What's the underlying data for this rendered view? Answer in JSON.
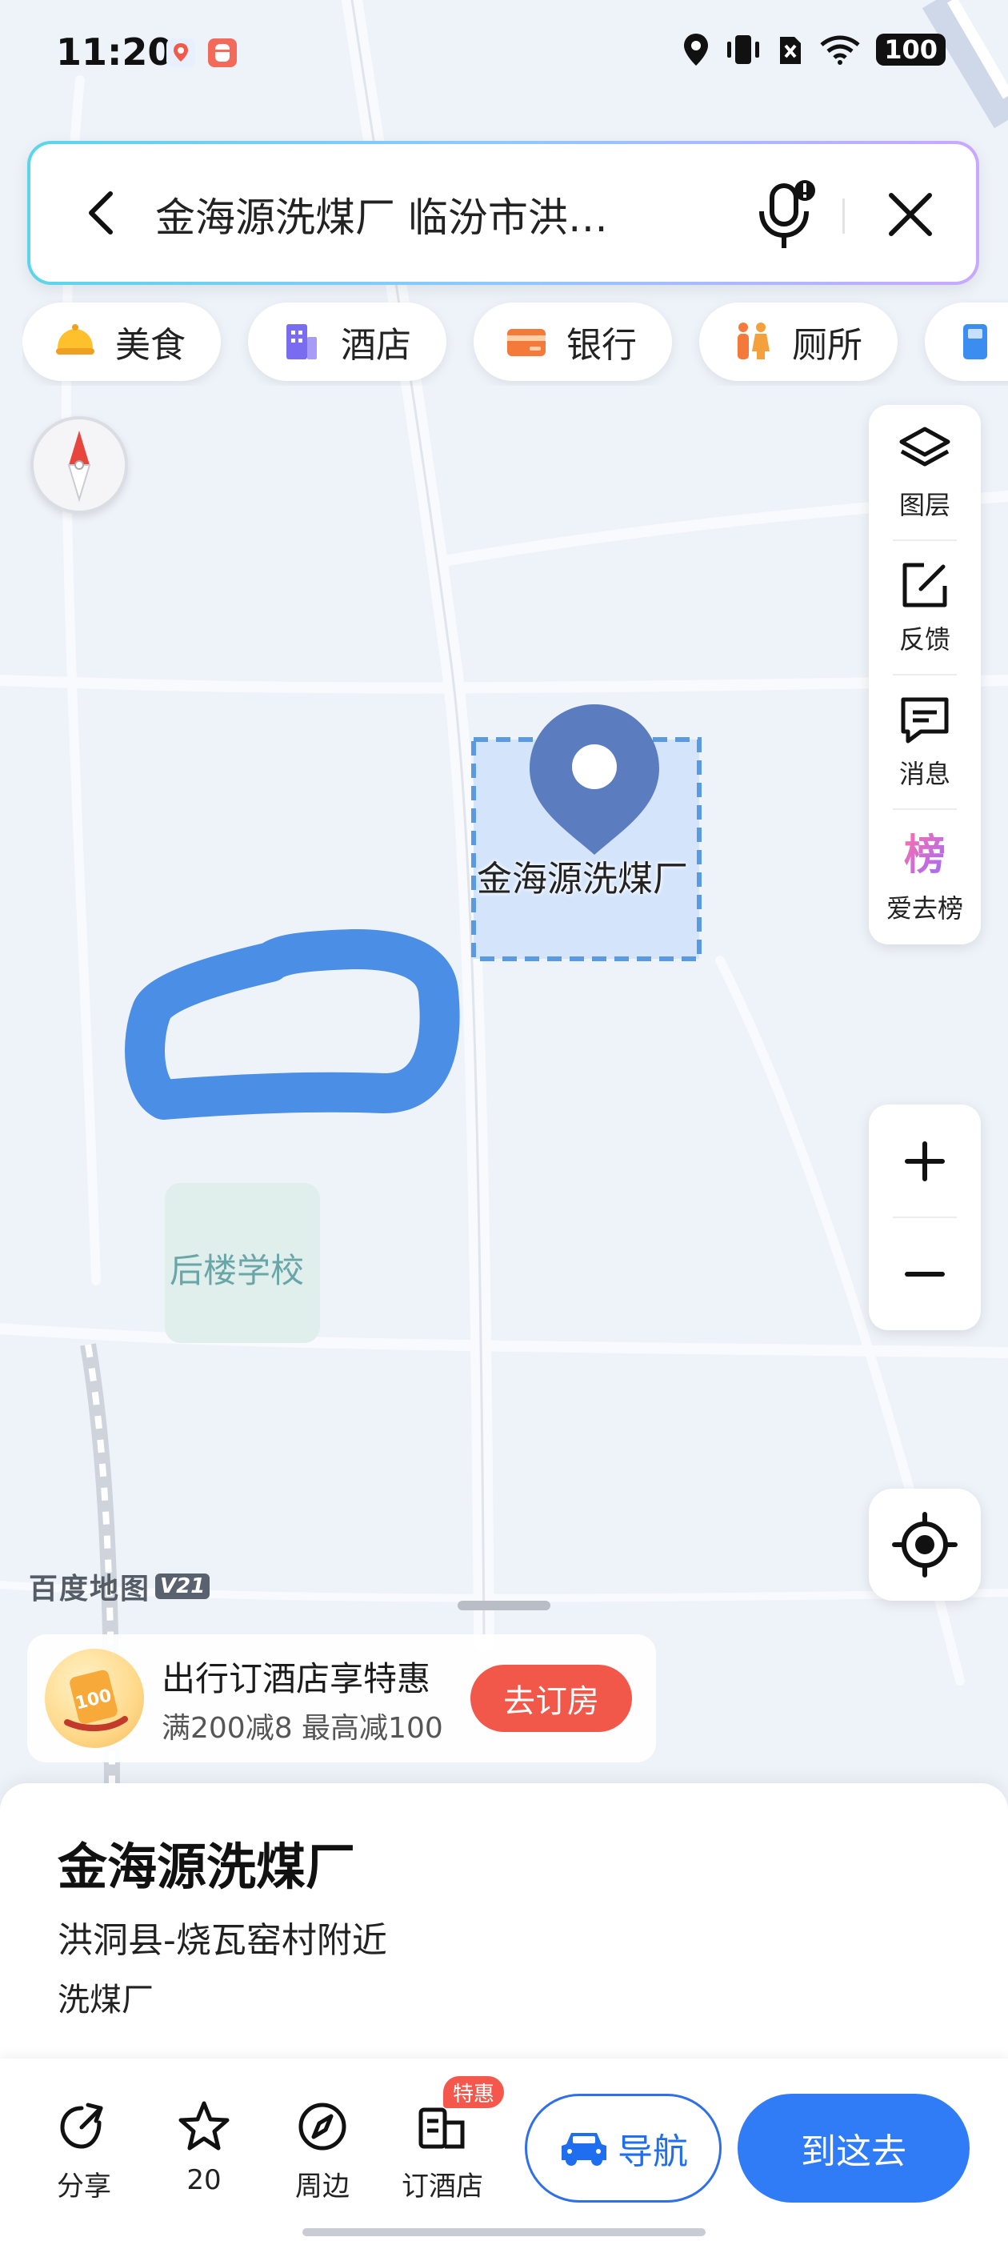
{
  "status_bar": {
    "time": "11:20",
    "battery": "100"
  },
  "search": {
    "query": "金海源洗煤厂 临汾市洪…"
  },
  "categories": [
    {
      "label": "美食",
      "icon": "food-icon"
    },
    {
      "label": "酒店",
      "icon": "hotel-icon"
    },
    {
      "label": "银行",
      "icon": "bank-icon"
    },
    {
      "label": "厕所",
      "icon": "toilet-icon"
    }
  ],
  "side_tools": [
    {
      "label": "图层",
      "icon": "layers-icon"
    },
    {
      "label": "反馈",
      "icon": "feedback-icon"
    },
    {
      "label": "消息",
      "icon": "message-icon"
    },
    {
      "label": "爱去榜",
      "icon": "ranking-icon",
      "glyph": "榜"
    }
  ],
  "map": {
    "poi_label": "金海源洗煤厂",
    "school_label": "后楼学校",
    "watermark": "百度地图",
    "watermark_version": "V21"
  },
  "promo": {
    "title": "出行订酒店享特惠",
    "subtitle": "满200减8 最高减100",
    "button": "去订房",
    "badge_value": "100"
  },
  "place": {
    "name": "金海源洗煤厂",
    "address": "洪洞县-烧瓦窑村附近",
    "category": "洗煤厂"
  },
  "actions": {
    "share": "分享",
    "favorite_count": "20",
    "nearby": "周边",
    "book_hotel": "订酒店",
    "hotel_badge": "特惠",
    "navigate": "导航",
    "go_there": "到这去"
  },
  "colors": {
    "accent_blue": "#2f7cf6",
    "promo_red": "#f2584a",
    "marker": "#5b7dbf",
    "drawn_stroke": "#4a8ee6"
  }
}
